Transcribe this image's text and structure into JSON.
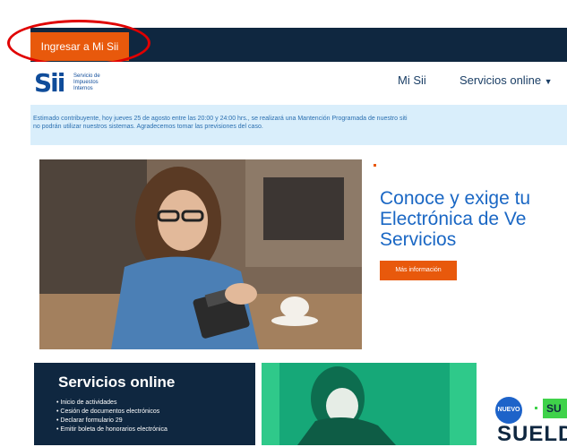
{
  "header": {
    "login_label": "Ingresar a Mi Sii"
  },
  "logo": {
    "mark": "Sii",
    "subtitle_line1": "Servicio de",
    "subtitle_line2": "Impuestos",
    "subtitle_line3": "Internos"
  },
  "nav": {
    "items": [
      {
        "label": "Mi Sii"
      },
      {
        "label": "Servicios online"
      }
    ],
    "dropdown_icon": "caret-down-icon"
  },
  "notice": {
    "line1": "Estimado contribuyente, hoy jueves 25 de agosto entre las 20:00 y 24:00 hrs., se realizará una Mantención Programada de nuestro siti",
    "line2": "no podrán utilizar nuestros sistemas. Agradecemos tomar las previsiones del caso."
  },
  "hero": {
    "title_line1": "Conoce y exige tu",
    "title_line2": "Electrónica de Ve",
    "title_line3": "Servicios",
    "button_label": "Más información"
  },
  "services": {
    "title": "Servicios online",
    "items": [
      "Inicio de actividades",
      "Cesión de documentos electrónicos",
      "Declarar formulario 29",
      "Emitir boleta de honorarios electrónica"
    ]
  },
  "promo": {
    "badge": "NUEVO",
    "tag": "SU",
    "headline": "SUELD"
  },
  "colors": {
    "brand_dark": "#0f2740",
    "accent_orange": "#e8590c",
    "link_blue": "#1a67c4",
    "notice_bg": "#d9eefb",
    "promo_green": "#3fd24a",
    "annotation_red": "#e00000"
  }
}
